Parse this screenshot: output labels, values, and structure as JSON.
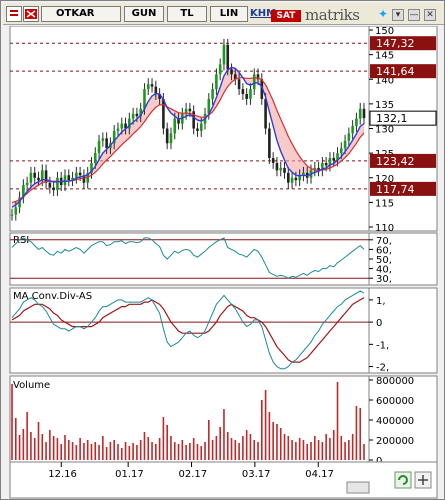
{
  "toolbar": {
    "symbol": "OTKAR",
    "period": "GUN",
    "currency": "TL",
    "scale": "LIN",
    "khm_label": "KHM",
    "action_label": "SAT",
    "logo": "matriks",
    "icons": [
      "menu-icon",
      "flag-icon",
      "twitter-icon",
      "minimize-icon",
      "close-icon"
    ]
  },
  "colors": {
    "price_axis_box": "#8b1010",
    "ma_fast": "#2f3fd8",
    "ma_slow": "#d23030",
    "rsi_line": "#1b8a9a",
    "volume_bar": "#c02828"
  },
  "chart_data": [
    {
      "type": "line",
      "title": "",
      "ylim": [
        110,
        150
      ],
      "x_ticks": [
        "12.16",
        "01.17",
        "02.17",
        "03.17",
        "04.17"
      ],
      "y_ticks": [
        110,
        115,
        120,
        125,
        130,
        135,
        140,
        145,
        150
      ],
      "price_levels": [
        "147,32",
        "141,64",
        "123,42",
        "117,74"
      ],
      "current_price": "132,1",
      "close": [
        112.5,
        114.0,
        116.0,
        118.5,
        119.0,
        121.0,
        120.0,
        119.5,
        121.5,
        119.0,
        118.0,
        117.5,
        120.0,
        118.5,
        120.5,
        119.5,
        120.0,
        121.0,
        120.5,
        119.0,
        121.0,
        123.0,
        125.0,
        127.5,
        128.0,
        126.0,
        127.0,
        129.5,
        130.0,
        131.0,
        130.0,
        132.0,
        133.0,
        132.5,
        134.0,
        138.0,
        139.0,
        138.5,
        137.0,
        136.0,
        130.0,
        127.0,
        129.0,
        132.0,
        131.0,
        133.0,
        134.0,
        133.5,
        130.0,
        129.5,
        131.0,
        133.0,
        136.0,
        138.0,
        141.0,
        143.0,
        147.0,
        142.0,
        141.0,
        140.0,
        138.0,
        137.0,
        136.0,
        138.0,
        141.0,
        140.0,
        136.0,
        130.0,
        124.0,
        123.0,
        121.5,
        122.0,
        121.0,
        119.0,
        120.0,
        119.5,
        120.5,
        121.0,
        120.0,
        121.5,
        122.0,
        121.5,
        123.0,
        122.5,
        124.0,
        123.5,
        125.0,
        126.0,
        127.5,
        129.0,
        130.5,
        132.0,
        134.0,
        132.1
      ],
      "ma_fast": [
        114.0,
        114.5,
        115.2,
        116.2,
        117.2,
        118.1,
        118.8,
        119.2,
        119.6,
        119.6,
        119.4,
        119.1,
        119.2,
        119.2,
        119.3,
        119.3,
        119.5,
        119.9,
        120.2,
        120.3,
        120.6,
        121.3,
        122.3,
        123.7,
        125.0,
        125.8,
        126.6,
        127.5,
        128.4,
        129.3,
        129.9,
        130.6,
        131.3,
        131.9,
        132.7,
        134.0,
        135.5,
        136.6,
        137.1,
        137.0,
        135.9,
        134.2,
        133.1,
        132.5,
        131.9,
        132.1,
        132.5,
        132.8,
        132.3,
        131.7,
        131.5,
        131.9,
        132.9,
        134.4,
        136.3,
        138.4,
        140.7,
        141.9,
        142.4,
        142.2,
        141.4,
        140.3,
        139.1,
        138.8,
        139.2,
        139.3,
        138.5,
        136.4,
        133.4,
        130.5,
        127.6,
        125.4,
        123.6,
        121.9,
        121.1,
        120.5,
        120.4,
        120.5,
        120.4,
        120.7,
        121.1,
        121.3,
        121.8,
        122.0,
        122.6,
        122.9,
        123.6,
        124.3,
        125.3,
        126.4,
        127.6,
        128.9,
        130.4,
        131.0
      ],
      "ma_slow": [
        115.0,
        115.2,
        115.6,
        116.2,
        116.8,
        117.5,
        118.0,
        118.5,
        119.0,
        119.2,
        119.3,
        119.3,
        119.3,
        119.3,
        119.3,
        119.3,
        119.4,
        119.6,
        119.8,
        119.9,
        120.1,
        120.5,
        121.1,
        121.9,
        122.8,
        123.6,
        124.3,
        125.1,
        125.9,
        126.7,
        127.4,
        128.1,
        128.9,
        129.6,
        130.4,
        131.4,
        132.5,
        133.5,
        134.3,
        134.8,
        134.8,
        134.4,
        134.0,
        133.6,
        133.2,
        133.1,
        133.1,
        133.1,
        132.8,
        132.5,
        132.3,
        132.3,
        132.7,
        133.4,
        134.5,
        135.8,
        137.3,
        138.5,
        139.4,
        140.0,
        140.3,
        140.3,
        140.2,
        140.2,
        140.3,
        140.3,
        139.9,
        138.9,
        137.3,
        135.6,
        133.7,
        131.9,
        130.2,
        128.4,
        126.9,
        125.5,
        124.3,
        123.3,
        122.4,
        121.9,
        121.6,
        121.5,
        121.6,
        121.7,
        122.0,
        122.3,
        122.8,
        123.4,
        124.1,
        124.9,
        125.9,
        127.0,
        128.2,
        129.1
      ]
    },
    {
      "type": "line",
      "title": "RSI",
      "ylim": [
        25,
        75
      ],
      "y_ticks": [
        30,
        40,
        50,
        60,
        70
      ],
      "values": [
        62,
        66,
        70,
        72,
        70,
        68,
        64,
        60,
        62,
        58,
        55,
        54,
        58,
        56,
        60,
        58,
        60,
        62,
        60,
        56,
        60,
        64,
        66,
        68,
        68,
        64,
        65,
        68,
        68,
        69,
        66,
        68,
        68,
        67,
        68,
        72,
        72,
        70,
        66,
        63,
        54,
        50,
        54,
        58,
        56,
        59,
        60,
        59,
        54,
        52,
        55,
        58,
        62,
        65,
        68,
        70,
        72,
        62,
        60,
        58,
        55,
        54,
        52,
        56,
        60,
        58,
        52,
        44,
        36,
        34,
        32,
        33,
        32,
        30,
        32,
        31,
        33,
        35,
        33,
        36,
        38,
        37,
        40,
        40,
        43,
        42,
        46,
        49,
        52,
        55,
        58,
        61,
        64,
        60
      ]
    },
    {
      "type": "line",
      "title": "MA Conv.Div-AS",
      "ylim": [
        -2.2,
        1.4
      ],
      "y_ticks": [
        -2,
        -1,
        0,
        1
      ],
      "macd": [
        0.2,
        0.4,
        0.6,
        0.9,
        1.0,
        1.1,
        1.0,
        0.8,
        0.7,
        0.5,
        0.2,
        -0.1,
        -0.2,
        -0.3,
        -0.3,
        -0.4,
        -0.3,
        -0.2,
        -0.2,
        -0.3,
        -0.2,
        0.0,
        0.2,
        0.5,
        0.7,
        0.7,
        0.8,
        0.9,
        1.0,
        1.0,
        0.9,
        0.9,
        0.9,
        0.9,
        0.9,
        1.0,
        1.1,
        1.0,
        0.7,
        0.4,
        -0.3,
        -0.9,
        -1.1,
        -1.0,
        -0.9,
        -0.7,
        -0.5,
        -0.4,
        -0.6,
        -0.7,
        -0.6,
        -0.4,
        0.0,
        0.4,
        0.8,
        1.0,
        1.2,
        1.0,
        0.8,
        0.6,
        0.3,
        0.0,
        -0.2,
        -0.1,
        0.1,
        0.1,
        -0.2,
        -0.8,
        -1.4,
        -1.8,
        -2.0,
        -2.1,
        -2.1,
        -2.0,
        -1.8,
        -1.7,
        -1.5,
        -1.3,
        -1.1,
        -0.9,
        -0.6,
        -0.4,
        -0.1,
        0.1,
        0.3,
        0.5,
        0.7,
        0.8,
        1.0,
        1.1,
        1.2,
        1.3,
        1.4,
        1.3
      ],
      "signal": [
        0.1,
        0.2,
        0.3,
        0.5,
        0.6,
        0.7,
        0.8,
        0.8,
        0.8,
        0.7,
        0.6,
        0.4,
        0.3,
        0.1,
        0.0,
        -0.1,
        -0.2,
        -0.2,
        -0.2,
        -0.2,
        -0.2,
        -0.2,
        -0.1,
        0.0,
        0.2,
        0.3,
        0.4,
        0.5,
        0.6,
        0.7,
        0.7,
        0.8,
        0.8,
        0.8,
        0.8,
        0.9,
        0.9,
        1.0,
        0.9,
        0.8,
        0.6,
        0.3,
        0.0,
        -0.2,
        -0.4,
        -0.5,
        -0.5,
        -0.5,
        -0.5,
        -0.5,
        -0.5,
        -0.5,
        -0.4,
        -0.2,
        0.0,
        0.3,
        0.5,
        0.7,
        0.8,
        0.7,
        0.6,
        0.5,
        0.3,
        0.2,
        0.2,
        0.1,
        0.0,
        -0.2,
        -0.5,
        -0.8,
        -1.1,
        -1.3,
        -1.5,
        -1.7,
        -1.8,
        -1.8,
        -1.8,
        -1.7,
        -1.6,
        -1.4,
        -1.2,
        -1.0,
        -0.8,
        -0.6,
        -0.4,
        -0.2,
        0.0,
        0.2,
        0.4,
        0.6,
        0.8,
        0.9,
        1.0,
        1.1
      ]
    },
    {
      "type": "bar",
      "title": "Volume",
      "ylim": [
        0,
        800000
      ],
      "y_ticks": [
        0,
        200000,
        400000,
        600000,
        800000
      ],
      "values": [
        760000,
        420000,
        250000,
        310000,
        480000,
        280000,
        220000,
        380000,
        260000,
        180000,
        300000,
        240000,
        220000,
        160000,
        250000,
        200000,
        180000,
        150000,
        220000,
        170000,
        200000,
        160000,
        180000,
        150000,
        240000,
        130000,
        180000,
        200000,
        160000,
        120000,
        180000,
        140000,
        170000,
        150000,
        200000,
        280000,
        230000,
        180000,
        160000,
        220000,
        430000,
        350000,
        240000,
        180000,
        160000,
        200000,
        150000,
        170000,
        220000,
        160000,
        140000,
        180000,
        400000,
        200000,
        240000,
        330000,
        510000,
        280000,
        220000,
        200000,
        170000,
        240000,
        300000,
        260000,
        200000,
        180000,
        600000,
        700000,
        480000,
        380000,
        360000,
        320000,
        260000,
        240000,
        200000,
        180000,
        220000,
        200000,
        160000,
        180000,
        240000,
        200000,
        180000,
        260000,
        220000,
        300000,
        780000,
        240000,
        180000,
        200000,
        260000,
        540000,
        520000,
        160000
      ]
    }
  ]
}
